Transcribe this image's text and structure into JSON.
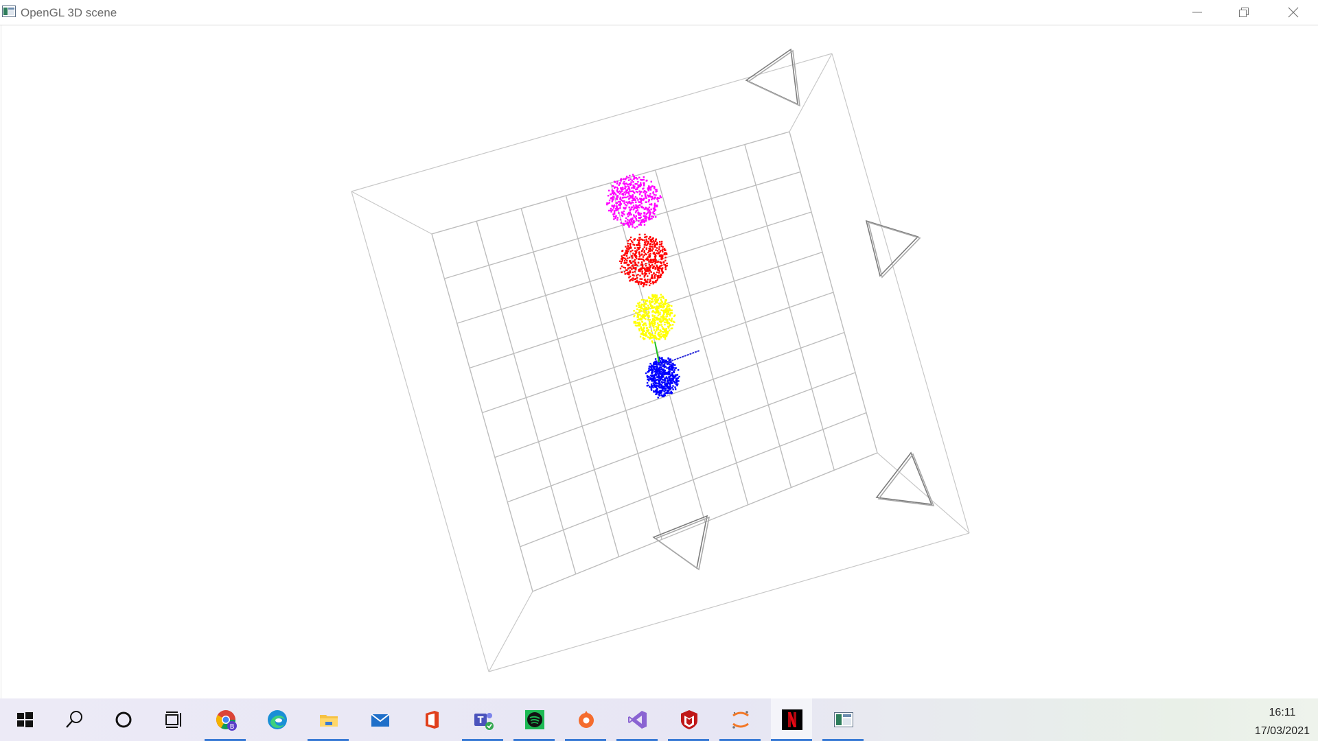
{
  "window": {
    "title": "OpenGL 3D scene",
    "buttons": [
      "minimize",
      "restore",
      "close"
    ]
  },
  "scene": {
    "description_shapes": [
      "grid-plane",
      "box-wireframe",
      "camera-frustums",
      "point-clouds",
      "axes"
    ],
    "point_clouds": [
      {
        "name": "magenta-cloud",
        "color": "#ff00ff"
      },
      {
        "name": "red-cloud",
        "color": "#ff0000"
      },
      {
        "name": "yellow-cloud",
        "color": "#ffff00"
      },
      {
        "name": "blue-cloud",
        "color": "#0000ff"
      }
    ],
    "grid_color": "#cccccc",
    "camera_color": "#808080"
  },
  "taskbar": {
    "items": [
      {
        "name": "start-button",
        "icon": "windows-logo-icon"
      },
      {
        "name": "search-button",
        "icon": "search-icon"
      },
      {
        "name": "cortana-button",
        "icon": "cortana-circle-icon"
      },
      {
        "name": "task-view-button",
        "icon": "task-view-icon"
      },
      {
        "name": "chrome-taskbar-item",
        "icon": "chrome-icon",
        "running": true
      },
      {
        "name": "edge-taskbar-item",
        "icon": "edge-icon"
      },
      {
        "name": "file-explorer-taskbar-item",
        "icon": "folder-icon",
        "running": true
      },
      {
        "name": "mail-taskbar-item",
        "icon": "mail-icon"
      },
      {
        "name": "office-taskbar-item",
        "icon": "office-icon"
      },
      {
        "name": "teams-taskbar-item",
        "icon": "teams-icon",
        "running": true
      },
      {
        "name": "spotify-taskbar-item",
        "icon": "spotify-icon",
        "running": true
      },
      {
        "name": "origin-taskbar-item",
        "icon": "origin-icon",
        "running": true
      },
      {
        "name": "visual-studio-taskbar-item",
        "icon": "visual-studio-icon",
        "running": true
      },
      {
        "name": "mcafee-taskbar-item",
        "icon": "mcafee-icon",
        "running": true
      },
      {
        "name": "jupyter-taskbar-item",
        "icon": "jupyter-icon",
        "running": true
      },
      {
        "name": "netflix-taskbar-item",
        "icon": "netflix-icon",
        "running": true
      },
      {
        "name": "opengl-app-taskbar-item",
        "icon": "app-window-icon",
        "running": true,
        "active": true
      }
    ],
    "clock": {
      "time": "16:11",
      "date": "17/03/2021"
    }
  }
}
